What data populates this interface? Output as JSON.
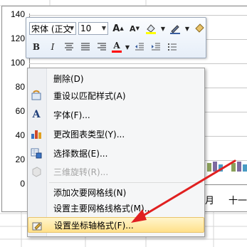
{
  "chart": {
    "y_ticks": [
      "140",
      "120",
      "100",
      "80",
      "60",
      "40",
      "20",
      "0"
    ],
    "x_labels_visible": [
      "月",
      "十一"
    ]
  },
  "toolbar": {
    "font_name": "宋体 (正文",
    "font_size": "10",
    "grow_font_icon": "grow-font-icon",
    "shrink_font_icon": "shrink-font-icon",
    "bold_label": "B",
    "italic_label": "I",
    "font_color_label": "A",
    "accent_fill": "#ffff00",
    "accent_font": "#ff0000"
  },
  "context_menu": {
    "items": [
      {
        "label": "删除(D)",
        "icon": "none",
        "disabled": false
      },
      {
        "label": "重设以匹配样式(A)",
        "icon": "reset-style-icon",
        "disabled": false
      },
      {
        "label": "字体(F)...",
        "icon": "font-icon",
        "disabled": false
      },
      {
        "label": "更改图表类型(Y)...",
        "icon": "chart-type-icon",
        "disabled": false
      },
      {
        "label": "选择数据(E)...",
        "icon": "select-data-icon",
        "disabled": false
      },
      {
        "label": "三维旋转(R)...",
        "icon": "3d-rotation-icon",
        "disabled": true
      },
      {
        "label": "添加次要网格线(N)",
        "icon": "none",
        "disabled": false
      },
      {
        "label": "设置主要网格线格式(M)...",
        "icon": "none",
        "disabled": false
      },
      {
        "label": "设置坐标轴格式(F)...",
        "icon": "format-axis-icon",
        "disabled": false,
        "highlighted": true
      }
    ]
  },
  "colors": {
    "arrow": "#e02020",
    "highlight": "#ffe08a"
  }
}
